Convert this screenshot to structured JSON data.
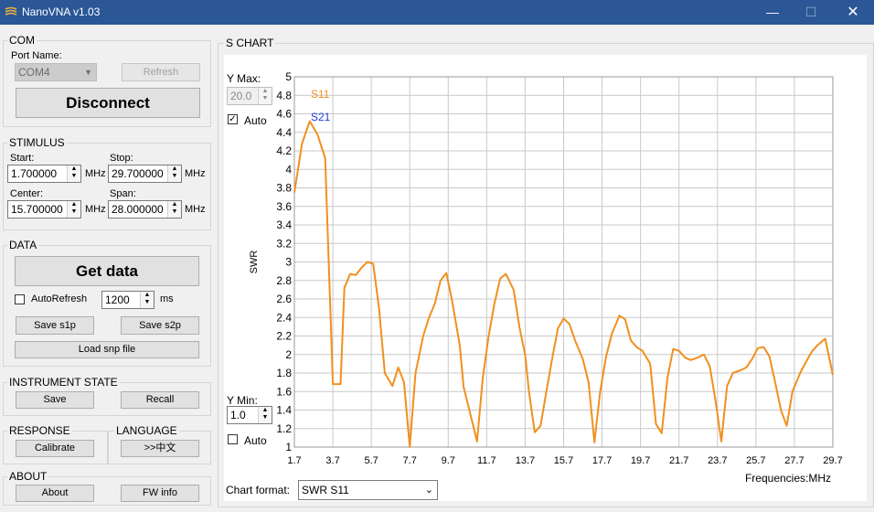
{
  "window": {
    "title": "NanoVNA v1.03",
    "minimize": "—",
    "maximize": "☐",
    "close": "✕"
  },
  "com": {
    "title": "COM",
    "port_label": "Port Name:",
    "port_value": "COM4",
    "refresh": "Refresh",
    "disconnect": "Disconnect"
  },
  "stimulus": {
    "title": "STIMULUS",
    "start_label": "Start:",
    "start_value": "1.700000",
    "stop_label": "Stop:",
    "stop_value": "29.700000",
    "center_label": "Center:",
    "center_value": "15.700000",
    "span_label": "Span:",
    "span_value": "28.000000",
    "unit": "MHz"
  },
  "data": {
    "title": "DATA",
    "get_data": "Get data",
    "autorefresh_label": "AutoRefresh",
    "autorefresh_value": "1200",
    "ms": "ms",
    "save_s1p": "Save s1p",
    "save_s2p": "Save s2p",
    "load_snp": "Load snp file"
  },
  "instrument": {
    "title": "INSTRUMENT STATE",
    "save": "Save",
    "recall": "Recall"
  },
  "response": {
    "title": "RESPONSE",
    "calibrate": "Calibrate"
  },
  "language": {
    "title": "LANGUAGE",
    "button": ">>中文"
  },
  "about": {
    "title": "ABOUT",
    "about": "About",
    "fw_info": "FW info"
  },
  "chart_panel": {
    "title": "S CHART",
    "ymax_label": "Y Max:",
    "ymax_value": "20.0",
    "auto_label": "Auto",
    "ymin_label": "Y Min:",
    "ymin_value": "1.0",
    "format_label": "Chart format:",
    "format_value": "SWR S11"
  },
  "chart_data": {
    "type": "line",
    "ylabel": "SWR",
    "xlabel": "Frequencies:MHz",
    "ylim": [
      1,
      5
    ],
    "xlim": [
      1.7,
      29.7
    ],
    "yticks": [
      "1",
      "1.2",
      "1.4",
      "1.6",
      "1.8",
      "2",
      "2.2",
      "2.4",
      "2.6",
      "2.8",
      "3",
      "3.2",
      "3.4",
      "3.6",
      "3.8",
      "4",
      "4.2",
      "4.4",
      "4.6",
      "4.8",
      "5"
    ],
    "xticks": [
      "1.7",
      "3.7",
      "5.7",
      "7.7",
      "9.7",
      "11.7",
      "13.7",
      "15.7",
      "17.7",
      "19.7",
      "21.7",
      "23.7",
      "25.7",
      "27.7",
      "29.7"
    ],
    "legend_position": "top-left",
    "series": [
      {
        "name": "S11",
        "color": "#f0901e",
        "x": [
          1.7,
          2.1,
          2.5,
          2.9,
          3.3,
          3.7,
          4.1,
          4.3,
          4.6,
          4.9,
          5.2,
          5.5,
          5.8,
          6.1,
          6.4,
          6.8,
          7.1,
          7.4,
          7.7,
          8.0,
          8.4,
          8.7,
          9.0,
          9.3,
          9.6,
          9.9,
          10.3,
          10.5,
          10.8,
          11.2,
          11.5,
          11.8,
          12.1,
          12.4,
          12.7,
          13.1,
          13.4,
          13.7,
          13.9,
          14.2,
          14.5,
          14.8,
          15.1,
          15.4,
          15.7,
          16.0,
          16.3,
          16.7,
          17.0,
          17.3,
          17.6,
          17.9,
          18.2,
          18.6,
          18.9,
          19.2,
          19.5,
          19.8,
          20.2,
          20.5,
          20.8,
          21.1,
          21.4,
          21.7,
          22.0,
          22.3,
          22.6,
          23.0,
          23.3,
          23.6,
          23.9,
          24.2,
          24.5,
          24.9,
          25.2,
          25.5,
          25.8,
          26.1,
          26.4,
          26.7,
          27.0,
          27.3,
          27.6,
          28.0,
          28.3,
          28.6,
          28.9,
          29.3,
          29.7
        ],
        "y": [
          3.75,
          4.28,
          4.52,
          4.38,
          4.12,
          1.68,
          1.68,
          2.72,
          2.87,
          2.86,
          2.94,
          3.0,
          2.98,
          2.5,
          1.8,
          1.66,
          1.86,
          1.7,
          1.0,
          1.8,
          2.2,
          2.4,
          2.55,
          2.8,
          2.88,
          2.58,
          2.1,
          1.65,
          1.4,
          1.06,
          1.75,
          2.2,
          2.55,
          2.82,
          2.87,
          2.7,
          2.3,
          2.0,
          1.6,
          1.16,
          1.23,
          1.6,
          1.95,
          2.28,
          2.39,
          2.33,
          2.15,
          1.95,
          1.7,
          1.05,
          1.6,
          1.97,
          2.22,
          2.42,
          2.38,
          2.15,
          2.08,
          2.04,
          1.9,
          1.25,
          1.15,
          1.75,
          2.06,
          2.04,
          1.97,
          1.94,
          1.96,
          2.0,
          1.87,
          1.5,
          1.06,
          1.66,
          1.8,
          1.83,
          1.86,
          1.95,
          2.07,
          2.08,
          1.98,
          1.7,
          1.4,
          1.23,
          1.6,
          1.8,
          1.92,
          2.03,
          2.1,
          2.17,
          1.78
        ]
      },
      {
        "name": "S21",
        "color": "#1f3bd4",
        "x": [],
        "y": []
      }
    ]
  }
}
